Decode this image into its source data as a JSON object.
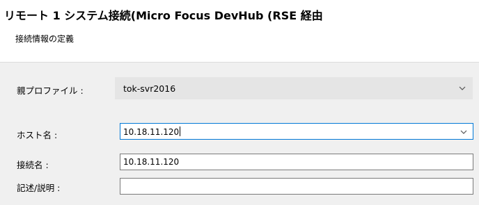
{
  "dialog": {
    "title": "リモート 1 システム接続(Micro Focus DevHub (RSE 経由",
    "subtitle": "接続情報の定義"
  },
  "form": {
    "parent_profile": {
      "label": "親プロファイル :",
      "value": "tok-svr2016"
    },
    "host_name": {
      "label": "ホスト名 :",
      "value": "10.18.11.120"
    },
    "connection_name": {
      "label": "接続名 :",
      "value": "10.18.11.120"
    },
    "description": {
      "label": "記述/説明 :",
      "value": ""
    }
  },
  "icons": {
    "dropdown": "chevron-down-icon"
  },
  "colors": {
    "focus_border": "#0078d7",
    "field_border": "#7a7a7a",
    "readonly_bg": "#e5e5e5",
    "dialog_bg": "#f0f0f0"
  }
}
